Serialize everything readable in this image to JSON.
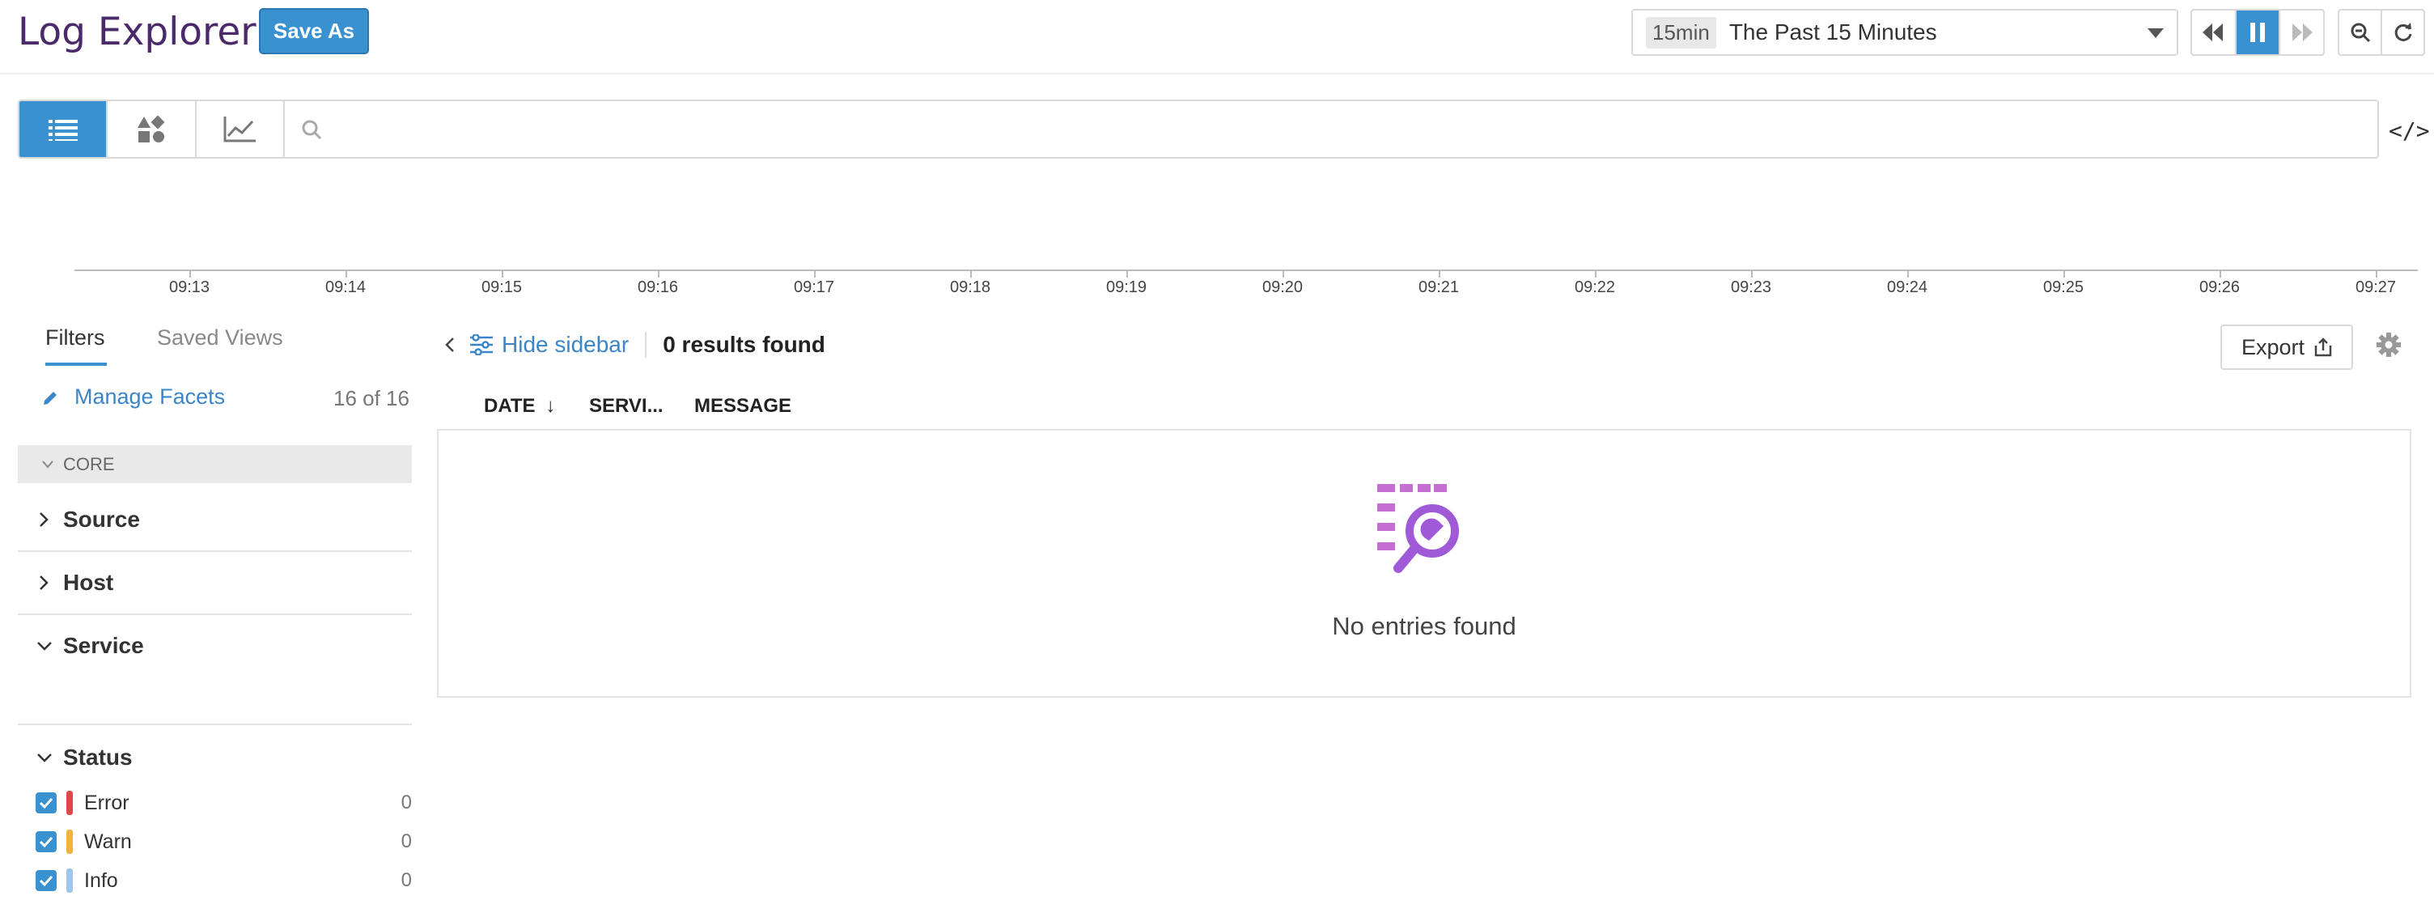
{
  "header": {
    "title": "Log Explorer",
    "save_as": "Save As",
    "timerange": {
      "badge": "15min",
      "label": "The Past 15 Minutes"
    }
  },
  "timeline": {
    "ticks": [
      "09:13",
      "09:14",
      "09:15",
      "09:16",
      "09:17",
      "09:18",
      "09:19",
      "09:20",
      "09:21",
      "09:22",
      "09:23",
      "09:24",
      "09:25",
      "09:26",
      "09:27"
    ]
  },
  "sidebar": {
    "tabs": {
      "filters": "Filters",
      "saved_views": "Saved Views"
    },
    "manage_facets": "Manage Facets",
    "facet_count": "16 of 16",
    "core_label": "CORE",
    "facets": [
      "Source",
      "Host",
      "Service",
      "Status"
    ],
    "status": [
      {
        "label": "Error",
        "count": "0",
        "color": "#e0474c"
      },
      {
        "label": "Warn",
        "count": "0",
        "color": "#f2b23c"
      },
      {
        "label": "Info",
        "count": "0",
        "color": "#9cc7ea"
      }
    ]
  },
  "results": {
    "hide_sidebar": "Hide sidebar",
    "count": "0 results found",
    "export": "Export",
    "columns": [
      "DATE",
      "SERVI...",
      "MESSAGE"
    ],
    "empty": "No entries found"
  },
  "colors": {
    "accent": "#3a91d0",
    "title": "#4a2a6b",
    "empty_icon": "#c56fd3",
    "empty_icon_alt": "#a05ad8"
  }
}
